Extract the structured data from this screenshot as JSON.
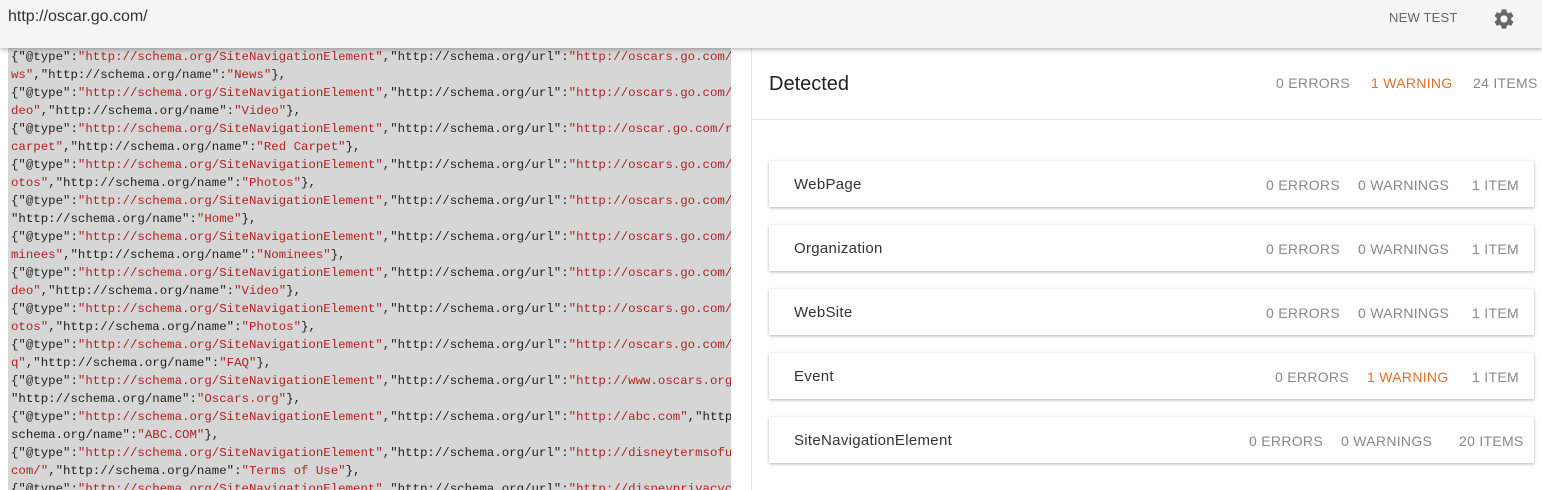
{
  "topbar": {
    "url": "http://oscar.go.com/",
    "new_test_label": "NEW TEST",
    "settings_icon": "gear-icon"
  },
  "code_lines": [
    [
      [
        "k",
        "{\"@type\":"
      ],
      [
        "s",
        "\"http://schema.org/SiteNavigationElement\""
      ],
      [
        "k",
        ",\"http://schema.org/url\":"
      ],
      [
        "s",
        "\"http://oscars.go.com//ne"
      ]
    ],
    [
      [
        "s",
        "ws\""
      ],
      [
        "k",
        ",\"http://schema.org/name\":"
      ],
      [
        "s",
        "\"News\""
      ],
      [
        "k",
        "},"
      ]
    ],
    [
      [
        "k",
        "{\"@type\":"
      ],
      [
        "s",
        "\"http://schema.org/SiteNavigationElement\""
      ],
      [
        "k",
        ",\"http://schema.org/url\":"
      ],
      [
        "s",
        "\"http://oscars.go.com//vi"
      ]
    ],
    [
      [
        "s",
        "deo\""
      ],
      [
        "k",
        ",\"http://schema.org/name\":"
      ],
      [
        "s",
        "\"Video\""
      ],
      [
        "k",
        "},"
      ]
    ],
    [
      [
        "k",
        "{\"@type\":"
      ],
      [
        "s",
        "\"http://schema.org/SiteNavigationElement\""
      ],
      [
        "k",
        ",\"http://schema.org/url\":"
      ],
      [
        "s",
        "\"http://oscar.go.com/red-"
      ]
    ],
    [
      [
        "s",
        "carpet\""
      ],
      [
        "k",
        ",\"http://schema.org/name\":"
      ],
      [
        "s",
        "\"Red Carpet\""
      ],
      [
        "k",
        "},"
      ]
    ],
    [
      [
        "k",
        "{\"@type\":"
      ],
      [
        "s",
        "\"http://schema.org/SiteNavigationElement\""
      ],
      [
        "k",
        ",\"http://schema.org/url\":"
      ],
      [
        "s",
        "\"http://oscars.go.com//ph"
      ]
    ],
    [
      [
        "s",
        "otos\""
      ],
      [
        "k",
        ",\"http://schema.org/name\":"
      ],
      [
        "s",
        "\"Photos\""
      ],
      [
        "k",
        "},"
      ]
    ],
    [
      [
        "k",
        "{\"@type\":"
      ],
      [
        "s",
        "\"http://schema.org/SiteNavigationElement\""
      ],
      [
        "k",
        ",\"http://schema.org/url\":"
      ],
      [
        "s",
        "\"http://oscars.go.com//\""
      ],
      [
        "k",
        ","
      ]
    ],
    [
      [
        "k",
        "\"http://schema.org/name\":"
      ],
      [
        "s",
        "\"Home\""
      ],
      [
        "k",
        "},"
      ]
    ],
    [
      [
        "k",
        "{\"@type\":"
      ],
      [
        "s",
        "\"http://schema.org/SiteNavigationElement\""
      ],
      [
        "k",
        ",\"http://schema.org/url\":"
      ],
      [
        "s",
        "\"http://oscars.go.com//no"
      ]
    ],
    [
      [
        "s",
        "minees\""
      ],
      [
        "k",
        ",\"http://schema.org/name\":"
      ],
      [
        "s",
        "\"Nominees\""
      ],
      [
        "k",
        "},"
      ]
    ],
    [
      [
        "k",
        "{\"@type\":"
      ],
      [
        "s",
        "\"http://schema.org/SiteNavigationElement\""
      ],
      [
        "k",
        ",\"http://schema.org/url\":"
      ],
      [
        "s",
        "\"http://oscars.go.com//vi"
      ]
    ],
    [
      [
        "s",
        "deo\""
      ],
      [
        "k",
        ",\"http://schema.org/name\":"
      ],
      [
        "s",
        "\"Video\""
      ],
      [
        "k",
        "},"
      ]
    ],
    [
      [
        "k",
        "{\"@type\":"
      ],
      [
        "s",
        "\"http://schema.org/SiteNavigationElement\""
      ],
      [
        "k",
        ",\"http://schema.org/url\":"
      ],
      [
        "s",
        "\"http://oscars.go.com//ph"
      ]
    ],
    [
      [
        "s",
        "otos\""
      ],
      [
        "k",
        ",\"http://schema.org/name\":"
      ],
      [
        "s",
        "\"Photos\""
      ],
      [
        "k",
        "},"
      ]
    ],
    [
      [
        "k",
        "{\"@type\":"
      ],
      [
        "s",
        "\"http://schema.org/SiteNavigationElement\""
      ],
      [
        "k",
        ",\"http://schema.org/url\":"
      ],
      [
        "s",
        "\"http://oscars.go.com//fa"
      ]
    ],
    [
      [
        "s",
        "q\""
      ],
      [
        "k",
        ",\"http://schema.org/name\":"
      ],
      [
        "s",
        "\"FAQ\""
      ],
      [
        "k",
        "},"
      ]
    ],
    [
      [
        "k",
        "{\"@type\":"
      ],
      [
        "s",
        "\"http://schema.org/SiteNavigationElement\""
      ],
      [
        "k",
        ",\"http://schema.org/url\":"
      ],
      [
        "s",
        "\"http://www.oscars.org/\""
      ],
      [
        "k",
        ","
      ]
    ],
    [
      [
        "k",
        "\"http://schema.org/name\":"
      ],
      [
        "s",
        "\"Oscars.org\""
      ],
      [
        "k",
        "},"
      ]
    ],
    [
      [
        "k",
        "{\"@type\":"
      ],
      [
        "s",
        "\"http://schema.org/SiteNavigationElement\""
      ],
      [
        "k",
        ",\"http://schema.org/url\":"
      ],
      [
        "s",
        "\"http://abc.com\""
      ],
      [
        "k",
        ",\"http://"
      ]
    ],
    [
      [
        "k",
        "schema.org/name\":"
      ],
      [
        "s",
        "\"ABC.COM\""
      ],
      [
        "k",
        "},"
      ]
    ],
    [
      [
        "k",
        "{\"@type\":"
      ],
      [
        "s",
        "\"http://schema.org/SiteNavigationElement\""
      ],
      [
        "k",
        ",\"http://schema.org/url\":"
      ],
      [
        "s",
        "\"http://disneytermsofuse."
      ]
    ],
    [
      [
        "s",
        "com/\""
      ],
      [
        "k",
        ",\"http://schema.org/name\":"
      ],
      [
        "s",
        "\"Terms of Use\""
      ],
      [
        "k",
        "},"
      ]
    ],
    [
      [
        "k",
        "{\"@type\":"
      ],
      [
        "s",
        "\"http://schema.org/SiteNavigationElement\""
      ],
      [
        "k",
        ",\"http://schema.org/url\":"
      ],
      [
        "s",
        "\"http://disneyprivacycent"
      ]
    ]
  ],
  "detected": {
    "title": "Detected",
    "errors": "0 ERRORS",
    "warnings": "1 WARNING",
    "items": "24 ITEMS",
    "warning_color": "#e0702a"
  },
  "types": [
    {
      "name": "WebPage",
      "errors": "0 ERRORS",
      "warnings": "0 WARNINGS",
      "items": "1 ITEM"
    },
    {
      "name": "Organization",
      "errors": "0 ERRORS",
      "warnings": "0 WARNINGS",
      "items": "1 ITEM"
    },
    {
      "name": "WebSite",
      "errors": "0 ERRORS",
      "warnings": "0 WARNINGS",
      "items": "1 ITEM"
    },
    {
      "name": "Event",
      "errors": "0 ERRORS",
      "warnings": "1 WARNING",
      "items": "1 ITEM"
    },
    {
      "name": "SiteNavigationElement",
      "errors": "0 ERRORS",
      "warnings": "0 WARNINGS",
      "items": "20 ITEMS"
    }
  ]
}
